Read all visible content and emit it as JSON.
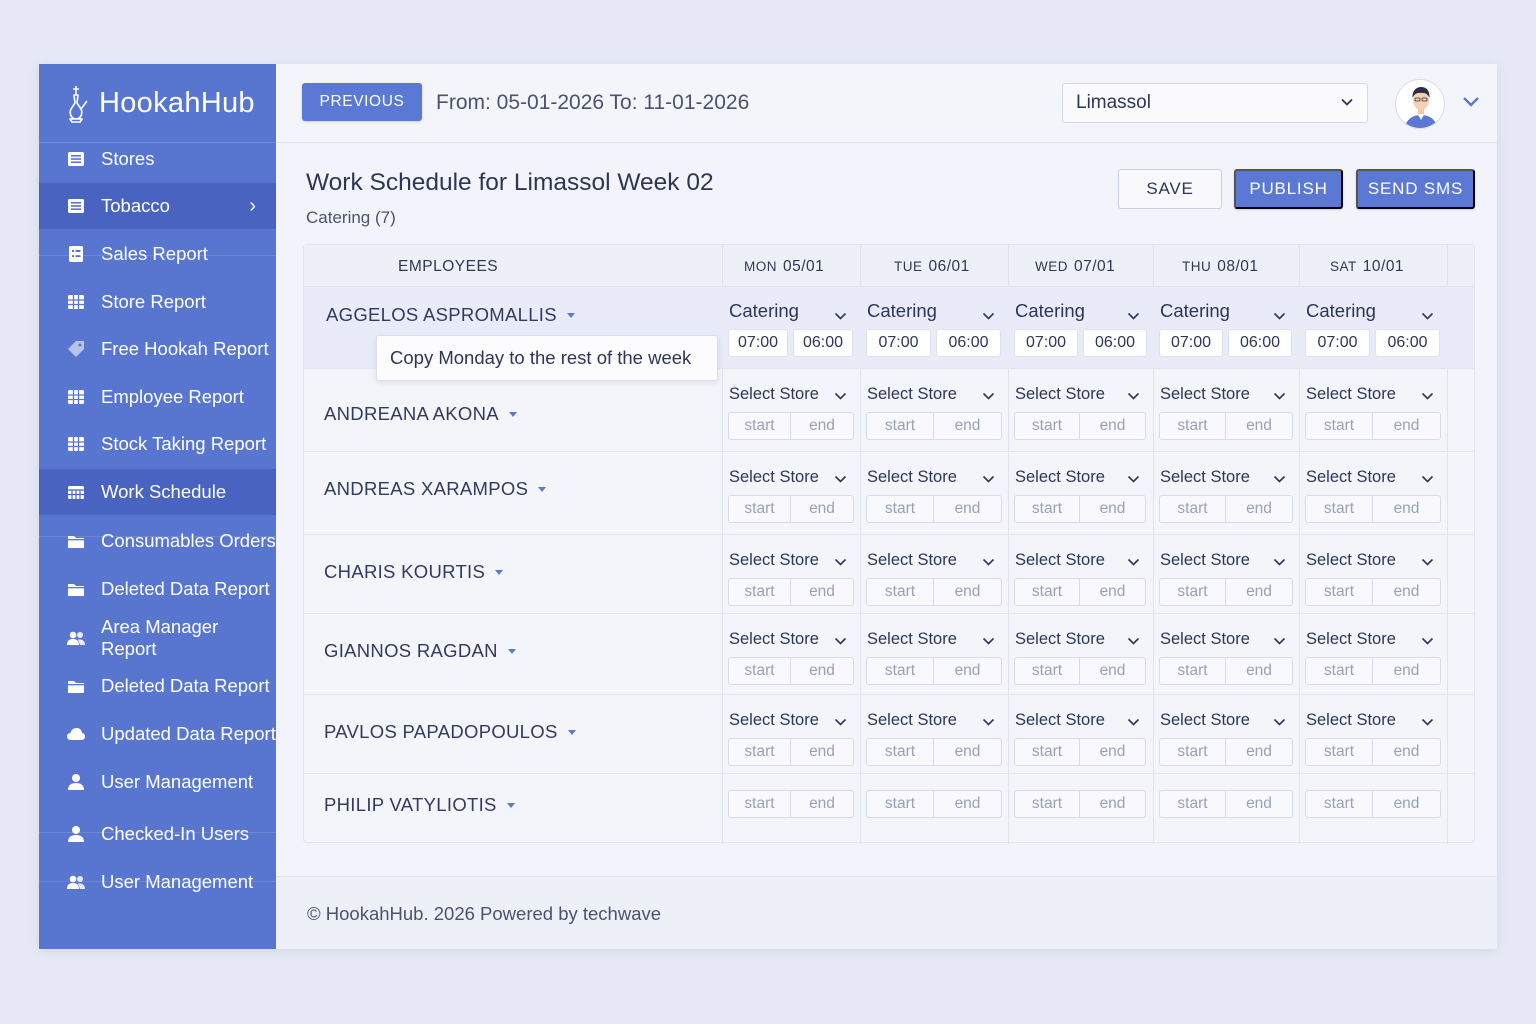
{
  "brand": {
    "name": "HookahHub",
    "logo_icon": "hookah-icon"
  },
  "sidebar": {
    "items": [
      {
        "label": "Stores",
        "icon": "list-icon"
      },
      {
        "label": "Tobacco",
        "icon": "list-icon",
        "active": true,
        "chevron": "›"
      },
      {
        "label": "Sales Report",
        "icon": "report-icon"
      },
      {
        "label": "Store Report",
        "icon": "grid-icon"
      },
      {
        "label": "Free Hookah Report",
        "icon": "tag-icon"
      },
      {
        "label": "Employee Report",
        "icon": "grid-icon"
      },
      {
        "label": "Stock Taking Report",
        "icon": "grid-icon"
      },
      {
        "label": "Work Schedule",
        "icon": "calendar-icon",
        "active": true
      },
      {
        "label": "Consumables Orders",
        "icon": "folder-icon"
      },
      {
        "label": "Deleted Data Report",
        "icon": "folder-icon"
      },
      {
        "label": "Area Manager Report",
        "icon": "users-icon"
      },
      {
        "label": "Deleted Data Report",
        "icon": "folder-icon"
      },
      {
        "label": "Updated Data Report",
        "icon": "cloud-icon"
      },
      {
        "label": "User Management",
        "icon": "user-icon"
      },
      {
        "label": "Checked-In Users",
        "icon": "user-icon"
      },
      {
        "label": "User Management",
        "icon": "users-icon"
      }
    ]
  },
  "header": {
    "previous_label": "PREVIOUS",
    "date_range": "From: 05-01-2026 To: 11-01-2026",
    "location": "Limassol",
    "avatar_icon": "user-avatar-icon"
  },
  "content": {
    "title": "Work Schedule for Limassol Week 02",
    "subtitle": "Catering (7)",
    "save_label": "SAVE",
    "publish_label": "PUBLISH",
    "sms_label": "SEND SMS"
  },
  "table": {
    "employees_header": "EMPLOYEES",
    "days": [
      {
        "dow": "MON",
        "date": "05/01"
      },
      {
        "dow": "TUE",
        "date": "06/01"
      },
      {
        "dow": "WED",
        "date": "07/01"
      },
      {
        "dow": "THU",
        "date": "08/01"
      },
      {
        "dow": "SAT",
        "date": "10/01"
      }
    ],
    "first_row": {
      "name": "AGGELOS ASPROMALLIS",
      "store": "Catering",
      "start": "07:00",
      "end": "06:00"
    },
    "rows": [
      {
        "name": "ANDREANA AKONA"
      },
      {
        "name": "ANDREAS XARAMPOS"
      },
      {
        "name": "CHARIS KOURTIS"
      },
      {
        "name": "GIANNOS RAGDAN"
      },
      {
        "name": "PAVLOS PAPADOPOULOS"
      },
      {
        "name": "PHILIP VATYLIOTIS"
      }
    ],
    "select_placeholder": "Select Store",
    "start_placeholder": "start",
    "end_placeholder": "end"
  },
  "tooltip": "Copy Monday to the rest of the week",
  "footer": "© HookahHub. 2026  Powered by techwave",
  "colors": {
    "accent": "#5a78d4",
    "sidebar": "#5876cf",
    "sidebar_active": "#4864c0"
  }
}
